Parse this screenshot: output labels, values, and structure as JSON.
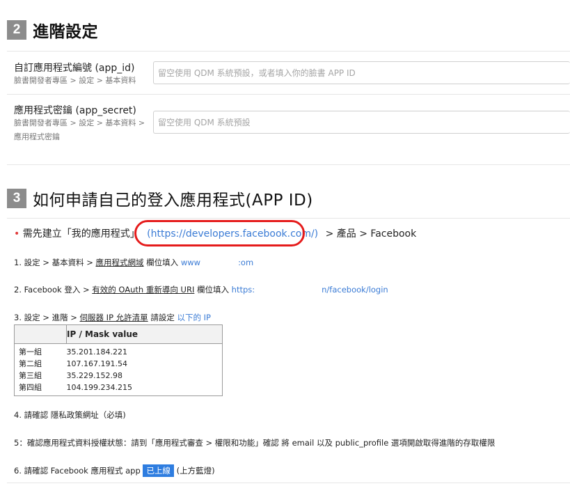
{
  "advanced": {
    "number": "2",
    "title": "進階設定",
    "app_id": {
      "label": "自訂應用程式編號 (app_id)",
      "hint": "臉書開發者專區 > 設定 > 基本資料",
      "placeholder": "留空使用 QDM 系統預設，或者填入你的臉書 APP ID"
    },
    "app_secret": {
      "label": "應用程式密鑰 (app_secret)",
      "hint_line1": "臉書開發者專區 > 設定 > 基本資料 >",
      "hint_line2": "應用程式密鑰",
      "placeholder": "留空使用 QDM 系統預設"
    }
  },
  "howto": {
    "number": "3",
    "title": "如何申請自己的登入應用程式(APP ID)",
    "intro": {
      "bullet": "•",
      "prefix": "需先建立「我的應用程式」",
      "link": "(https://developers.facebook.com/)",
      "suffix": "> 產品 > Facebook"
    },
    "step1": {
      "prefix": "1. 設定 > 基本資料 > ",
      "field": "應用程式網域",
      "middle": " 欄位填入 ",
      "value_start": "www",
      "value_end": ":om"
    },
    "step2": {
      "prefix": "2. Facebook 登入 > ",
      "field": "有效的 OAuth 重新導向 URI",
      "middle": " 欄位填入 ",
      "value_start": "https:",
      "value_end": "n/facebook/login"
    },
    "step3": {
      "prefix": "3. 設定 > 進階 > ",
      "field": "伺服器 IP 允許清單",
      "middle": " 請設定 ",
      "link": "以下的 IP"
    },
    "ip_table": {
      "header": "IP / Mask value",
      "rows": [
        {
          "group": "第一組",
          "ip": "35.201.184.221"
        },
        {
          "group": "第二組",
          "ip": "107.167.191.54"
        },
        {
          "group": "第三組",
          "ip": "35.229.152.98"
        },
        {
          "group": "第四組",
          "ip": "104.199.234.215"
        }
      ]
    },
    "step4": "4. 請確認 隱私政策網址（必填)",
    "step5": "5：確認應用程式資料授權狀態：請到「應用程式審查 > 權限和功能」確認 將 email 以及 public_profile 選項開啟取得進階的存取權限",
    "step6": {
      "prefix": "6. 請確認 Facebook 應用程式 app ",
      "badge": "已上線",
      "suffix": " (上方藍燈)"
    }
  },
  "colors": {
    "badge_gray": "#8c8c8c",
    "link_blue": "#3a7bd5",
    "highlight_red": "#e51b1b",
    "live_badge_blue": "#2e7de0"
  }
}
